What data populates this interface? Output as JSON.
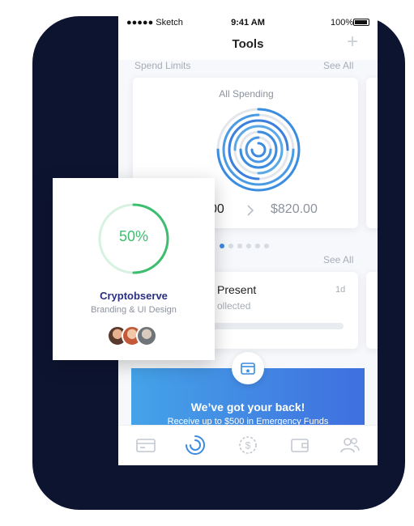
{
  "status_bar": {
    "carrier": "●●●●● Sketch",
    "time": "9:41 AM",
    "battery": "100%"
  },
  "nav": {
    "title": "Tools",
    "add_icon": "plus-icon"
  },
  "spend_limits": {
    "section_label": "Spend Limits",
    "see_all": "See All",
    "card_title": "All Spending",
    "spent_partial": "00",
    "limit": "$820.00",
    "arrow_icon": "chevron-right-icon",
    "page_dots": 6,
    "active_dot": 0
  },
  "goals": {
    "see_all": "See All",
    "title_partial": "Present",
    "subtitle_partial": "ollected",
    "time_ago": "1d"
  },
  "banner": {
    "title": "We’ve got your back!",
    "subtitle": "Receive up to $500 in Emergency Funds",
    "icon": "wallet-star-icon"
  },
  "tabbar": {
    "items": [
      {
        "icon": "card-icon"
      },
      {
        "icon": "tools-icon",
        "active": true
      },
      {
        "icon": "dollar-icon"
      },
      {
        "icon": "wallet-icon"
      },
      {
        "icon": "people-icon"
      }
    ]
  },
  "project_card": {
    "progress_text": "50%",
    "progress": 0.5,
    "name": "Cryptobserve",
    "subtitle": "Branding & UI Design",
    "more_icon": "more-dots-icon"
  },
  "colors": {
    "accent_blue": "#3d8ae0",
    "progress_green": "#3dbd6e",
    "project_name": "#2b2f80",
    "backdrop": "#0d1430"
  }
}
